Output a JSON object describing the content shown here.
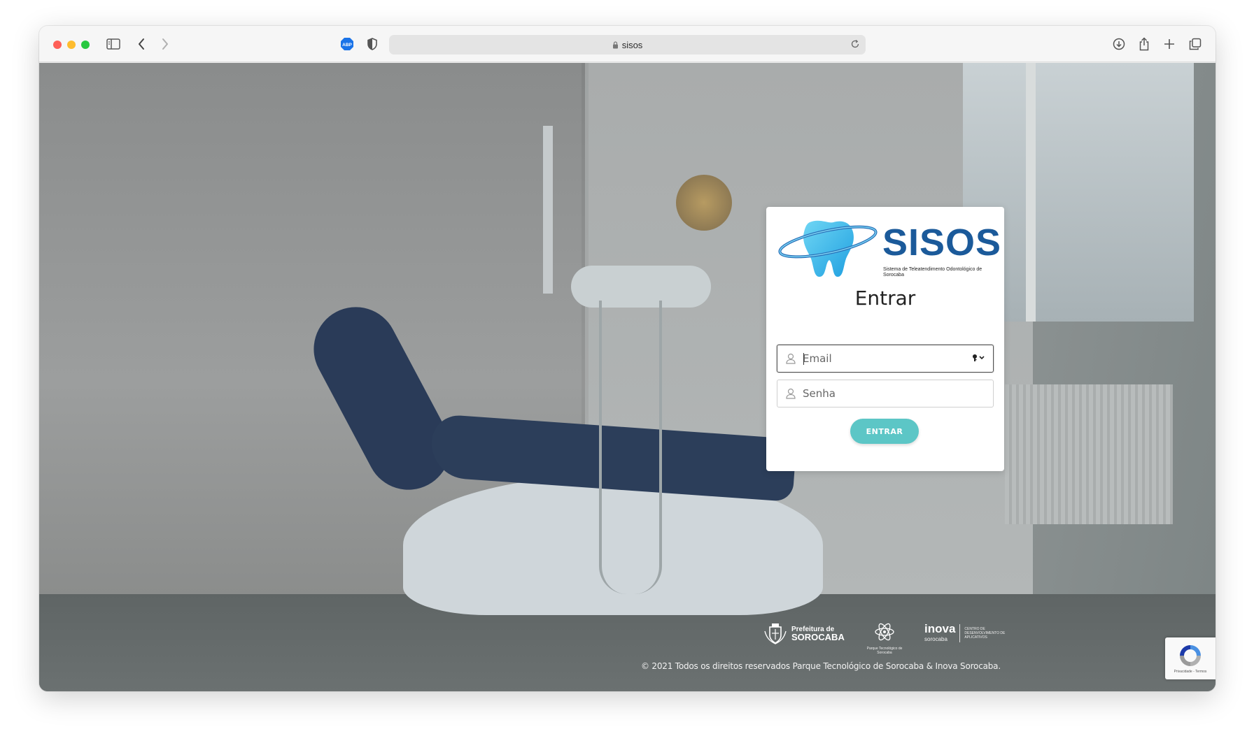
{
  "browser": {
    "url": "sisos",
    "extensions": {
      "abp_label": "ABP"
    }
  },
  "logo": {
    "title": "SISOS",
    "subtitle": "Sistema de Teleatendimento Odontológico de Sorocaba"
  },
  "login": {
    "title": "Entrar",
    "email_placeholder": "Email",
    "password_placeholder": "Senha",
    "submit_label": "ENTRAR"
  },
  "partners": {
    "prefeitura_line1": "Prefeitura de",
    "prefeitura_line2": "SOROCABA",
    "parque_label": "Parque Tecnológico de Sorocaba",
    "inova_name": "inova",
    "inova_sub": "sorocaba",
    "inova_centro": "CENTRO DE DESENVOLVIMENTO DE APLICATIVOS"
  },
  "footer": {
    "copyright": "© 2021 Todos os direitos reservados Parque Tecnológico de Sorocaba & Inova Sorocaba."
  },
  "recaptcha": {
    "terms": "Privacidade - Termos"
  },
  "colors": {
    "accent": "#5cc6c6",
    "brand_blue": "#1b5a9a",
    "tooth_cyan": "#2fb3e8"
  }
}
